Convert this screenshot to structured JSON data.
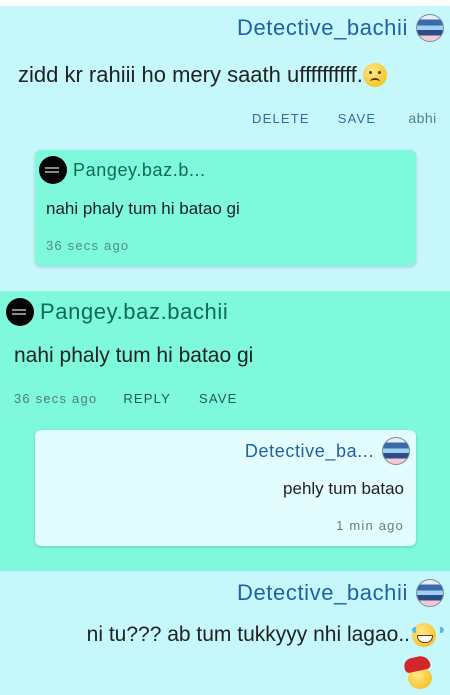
{
  "comment1": {
    "username": "Detective_bachii",
    "message": "zidd kr rahiii ho mery saath uffffffffff.",
    "emoji": "sad-face-emoji",
    "actions": {
      "delete": "DELETE",
      "save": "SAVE",
      "extra": "abhi"
    },
    "reply_preview": {
      "username": "Pangey.baz.b...",
      "message": "nahi phaly tum hi batao gi",
      "time": "36 secs ago"
    }
  },
  "comment2": {
    "username": "Pangey.baz.bachii",
    "message": "nahi phaly tum hi batao gi",
    "time": "36 secs ago",
    "actions": {
      "reply": "REPLY",
      "save": "SAVE"
    },
    "reply_preview": {
      "username": "Detective_ba...",
      "message": "pehly tum batao",
      "time": "1 min ago"
    }
  },
  "comment3": {
    "username": "Detective_bachii",
    "message": "ni tu??? ab tum tukkyyy nhi lagao..",
    "emoji": "laughing-tears-emoji"
  },
  "colors": {
    "light_bg": "#c6f8fb",
    "green_bg": "#7ef9dc",
    "username_blue": "#1f61a3",
    "username_green": "#0f6b52"
  }
}
